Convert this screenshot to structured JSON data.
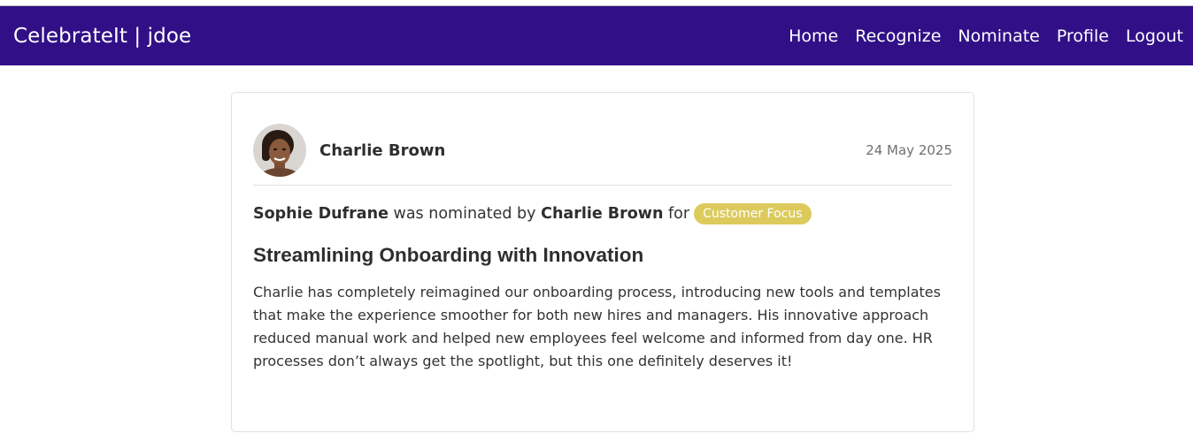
{
  "app": {
    "brand": "CelebrateIt | jdoe"
  },
  "nav": {
    "items": [
      {
        "label": "Home"
      },
      {
        "label": "Recognize"
      },
      {
        "label": "Nominate"
      },
      {
        "label": "Profile"
      },
      {
        "label": "Logout"
      }
    ]
  },
  "post": {
    "author": "Charlie Brown",
    "date": "24 May 2025",
    "nominee": "Sophie Dufrane",
    "text_nominated_by": "was nominated by",
    "nominator": "Charlie Brown",
    "text_for": "for",
    "category": "Customer Focus",
    "title": "Streamlining Onboarding with Innovation",
    "body": "Charlie has completely reimagined our onboarding process, introducing new tools and templates that make the experience smoother for both new hires and managers. His innovative approach reduced manual work and helped new employees feel welcome and informed from day one. HR processes don’t always get the spotlight, but this one definitely deserves it!"
  },
  "colors": {
    "navbar": "#311087",
    "badge": "#dccb5c",
    "card_border": "#e2e2e2"
  },
  "icons": {
    "avatar": "user-avatar-photo"
  }
}
